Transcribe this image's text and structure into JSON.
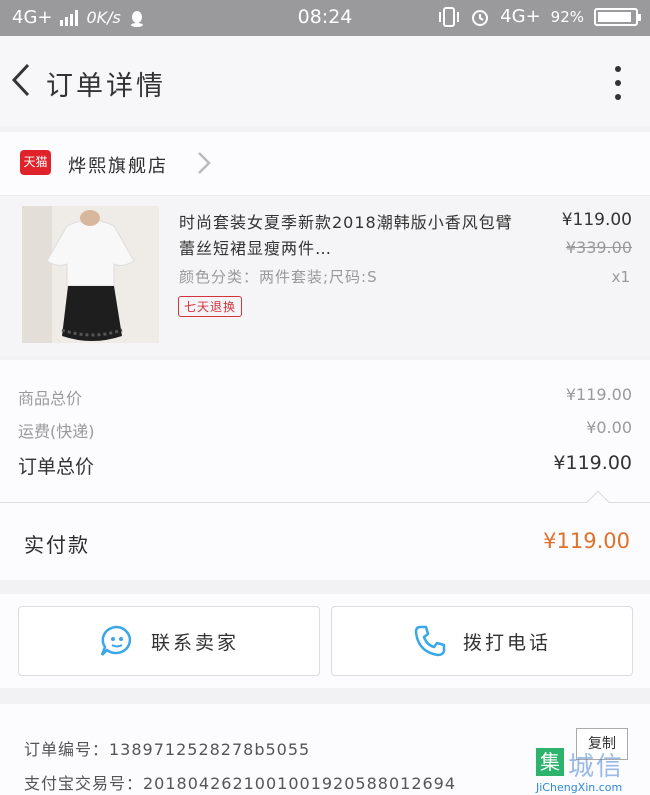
{
  "status_bar": {
    "network": "4G+",
    "speed": "0K/s",
    "time": "08:24",
    "network_right": "4G+",
    "battery": "92%"
  },
  "header": {
    "title": "订单详情",
    "back_icon": "chevron-left-icon",
    "more_icon": "more-vertical-icon"
  },
  "shop": {
    "badge": "天猫",
    "name": "烨熙旗舰店"
  },
  "product": {
    "title": "时尚套装女夏季新款2018潮韩版小香风包臂蕾丝短裙显瘦两件…",
    "spec": "颜色分类：两件套装;尺码:S",
    "tag": "七天退换",
    "price": "¥119.00",
    "original_price": "¥339.00",
    "quantity": "x1"
  },
  "summary": {
    "goods_total_label": "商品总价",
    "goods_total": "¥119.00",
    "shipping_label": "运费(快递)",
    "shipping": "¥0.00",
    "order_total_label": "订单总价",
    "order_total": "¥119.00"
  },
  "payment": {
    "label": "实付款",
    "amount": "¥119.00"
  },
  "actions": {
    "contact_seller": "联系卖家",
    "call_phone": "拨打电话"
  },
  "order_info": {
    "order_number": "订单编号：1389712528278b5055",
    "alipay_number": "支付宝交易号：2018042621001001920588012694",
    "copy": "复制"
  },
  "watermark": {
    "logo": "集",
    "text": "城信",
    "sub": "JiChengXin.com"
  },
  "colors": {
    "accent_price": "#e0712b",
    "tmall_red": "#e0232b",
    "icon_blue": "#3aa7e8"
  }
}
